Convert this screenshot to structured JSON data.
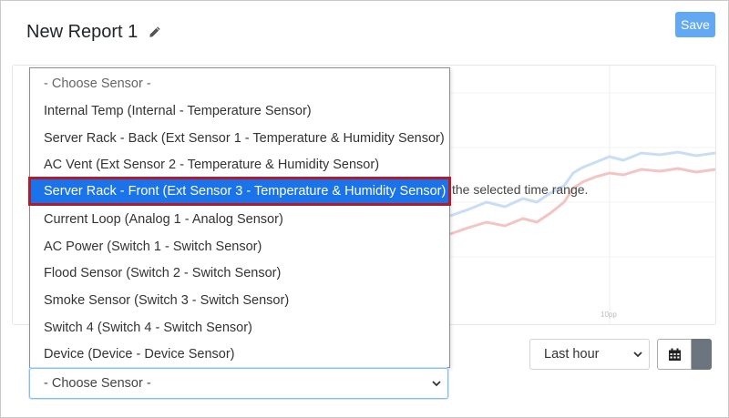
{
  "header": {
    "title": "New Report 1",
    "edit_icon": "pencil-icon",
    "save_label": "Save"
  },
  "chart": {
    "message": "the selected time range.",
    "x_tick_right": "10pp"
  },
  "sensor_dropdown": {
    "options": [
      "- Choose Sensor -",
      "Internal Temp (Internal - Temperature Sensor)",
      "Server Rack - Back (Ext Sensor 1 - Temperature & Humidity Sensor)",
      "AC Vent (Ext Sensor 2 - Temperature & Humidity Sensor)",
      "Server Rack - Front (Ext Sensor 3 - Temperature & Humidity Sensor)",
      "Current Loop (Analog 1 - Analog Sensor)",
      "AC Power (Switch 1 - Switch Sensor)",
      "Flood Sensor (Switch 2 - Switch Sensor)",
      "Smoke Sensor (Switch 3 - Switch Sensor)",
      "Switch 4 (Switch 4 - Switch Sensor)",
      "Device (Device - Device Sensor)"
    ],
    "highlighted_option": "Server Rack - Front (Ext Sensor 3 - Temperature & Humidity Sensor)",
    "selected_value": "- Choose Sensor -"
  },
  "time_range": {
    "selected_value": "Last hour"
  },
  "icons": {
    "calendar": "calendar-icon",
    "chevron": "chevron-down-icon"
  },
  "colors": {
    "accent": "#63a8f3",
    "highlight": "#1a73e8",
    "highlight_border": "#b01c2a",
    "series_blue": "#c9ddf7",
    "series_red": "#f4c4c4"
  }
}
